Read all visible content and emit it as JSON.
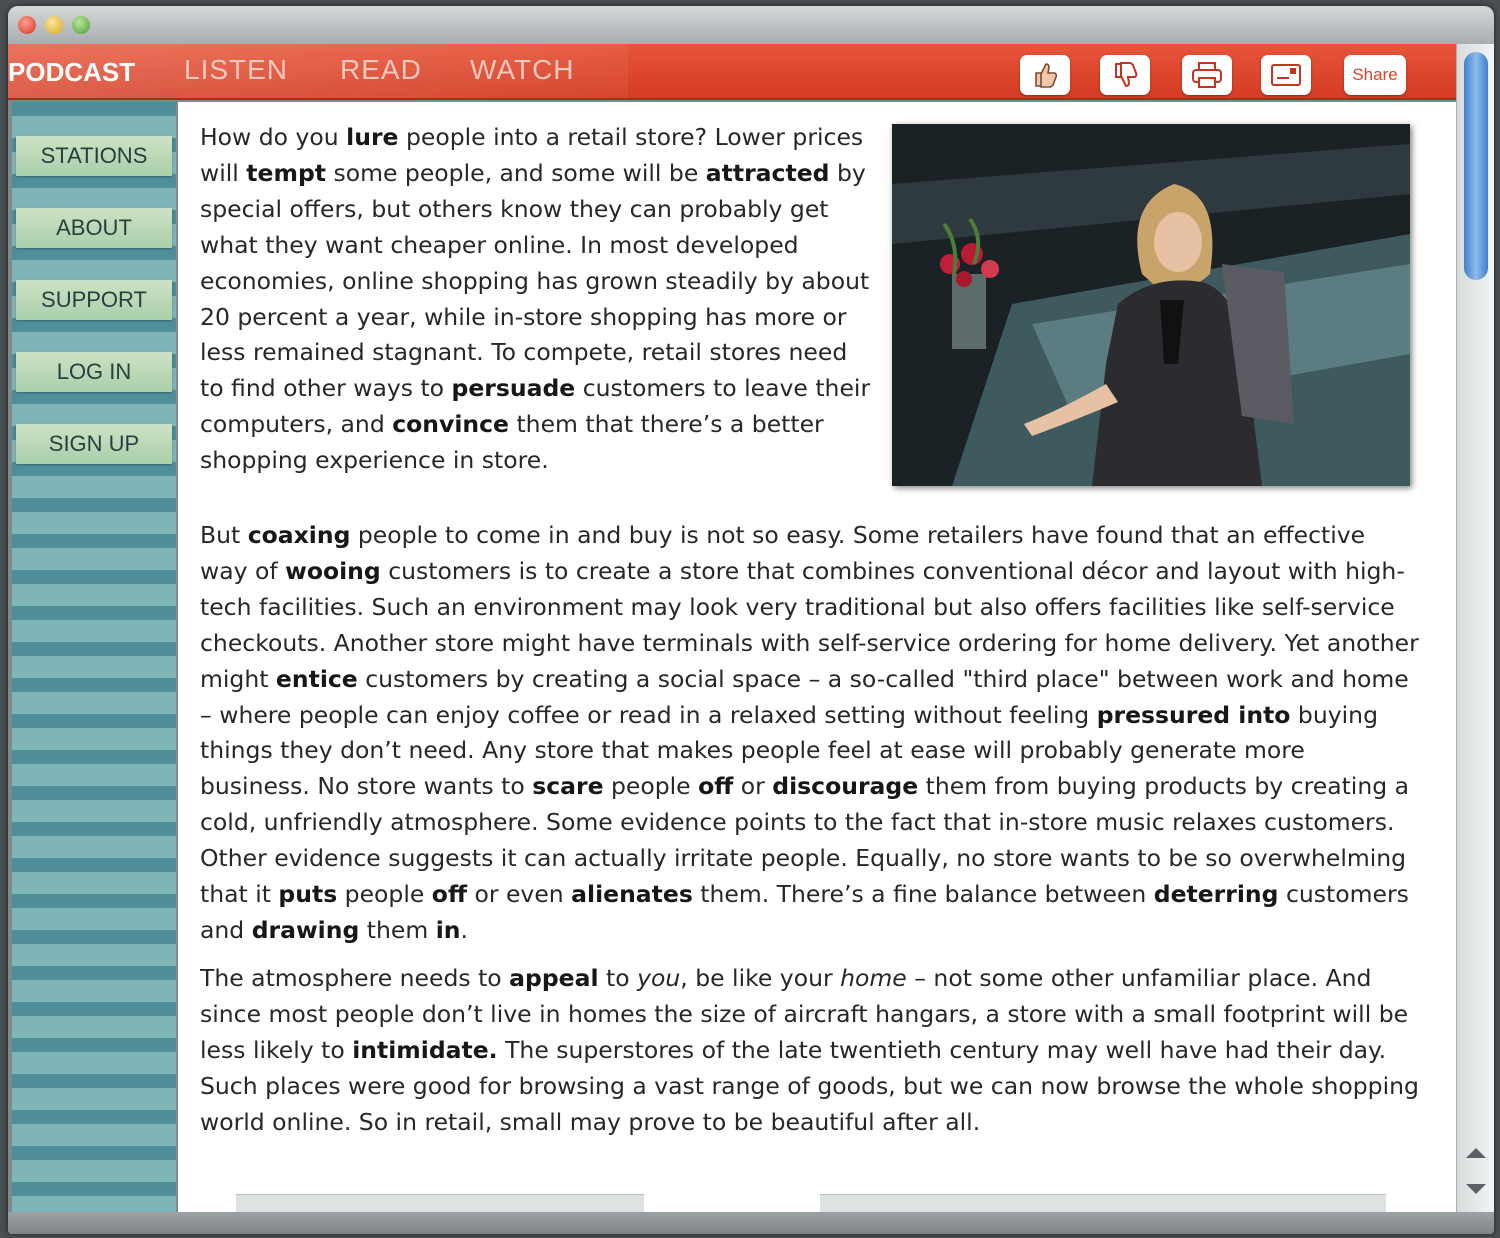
{
  "nav": {
    "podcast": "PODCAST",
    "listen": "LISTEN",
    "read": "READ",
    "watch": "WATCH"
  },
  "toolbar": {
    "like_icon": "thumbs-up-icon",
    "dislike_icon": "thumbs-down-icon",
    "print_icon": "printer-icon",
    "email_icon": "email-icon",
    "share_label": "Share"
  },
  "sidebar": {
    "items": [
      {
        "label": "STATIONS"
      },
      {
        "label": "ABOUT"
      },
      {
        "label": "SUPPORT"
      },
      {
        "label": "LOG IN"
      },
      {
        "label": "SIGN UP"
      }
    ]
  },
  "colors": {
    "brand_red": "#d94a2f",
    "sidebar_teal": "#5f9ea6",
    "button_green": "#bcd9b6"
  },
  "article": {
    "p1": [
      [
        "How do you ",
        ""
      ],
      [
        "lure",
        "b"
      ],
      [
        " people into a retail store? Lower prices will ",
        ""
      ],
      [
        "tempt",
        "b"
      ],
      [
        " some people, and some will be ",
        ""
      ],
      [
        "attracted",
        "b"
      ],
      [
        " by special offers, but others know they can probably get what they want cheaper online. In most developed economies, online shopping has grown steadily by about 20 percent a year, while in-store shopping has more or less remained stagnant. To compete, retail stores need to find other ways to ",
        ""
      ],
      [
        "persuade",
        "b"
      ],
      [
        " customers to leave their computers, and ",
        ""
      ],
      [
        "convince",
        "b"
      ],
      [
        " them that there’s a better shopping experience in store.",
        ""
      ]
    ],
    "p2": [
      [
        "But ",
        ""
      ],
      [
        "coaxing",
        "b"
      ],
      [
        " people to come in and buy is not so easy. Some retailers have found that an effective way of ",
        ""
      ],
      [
        "wooing",
        "b"
      ],
      [
        " customers is to create a store that combines conventional décor and layout with high-tech facilities. Such an environment may look very traditional but also offers facilities like self-service checkouts. Another store might have terminals with self-service ordering for home delivery. Yet another might ",
        ""
      ],
      [
        "entice",
        "b"
      ],
      [
        " customers by creating a social space – a so-called \"third place\" between work and home – where people can enjoy coffee or read in a relaxed setting without feeling ",
        ""
      ],
      [
        "pressured into",
        "b"
      ],
      [
        " buying things they don’t need. Any store that makes people feel at ease will probably generate more business. No store wants to ",
        ""
      ],
      [
        "scare",
        "b"
      ],
      [
        " people ",
        ""
      ],
      [
        "off",
        "b"
      ],
      [
        " or ",
        ""
      ],
      [
        "discourage",
        "b"
      ],
      [
        " them from buying products by creating a cold, unfriendly atmosphere. Some evidence points to the fact that in-store music relaxes customers. Other evidence suggests it can actually irritate people. Equally, no store wants to be so overwhelming that it ",
        ""
      ],
      [
        "puts",
        "b"
      ],
      [
        " people ",
        ""
      ],
      [
        "off",
        "b"
      ],
      [
        " or even ",
        ""
      ],
      [
        "alienates",
        "b"
      ],
      [
        " them. There’s a fine balance between ",
        ""
      ],
      [
        "deterring",
        "b"
      ],
      [
        " customers and ",
        ""
      ],
      [
        "drawing",
        "b"
      ],
      [
        " them ",
        ""
      ],
      [
        "in",
        "b"
      ],
      [
        ".",
        ""
      ]
    ],
    "p3": [
      [
        "The atmosphere needs to ",
        ""
      ],
      [
        "appeal",
        "b"
      ],
      [
        " to ",
        ""
      ],
      [
        "you",
        "i"
      ],
      [
        ", be like your ",
        ""
      ],
      [
        "home",
        "i"
      ],
      [
        " – not some other unfamiliar place. And since most people don’t live in homes the size of aircraft hangars, a store with a small footprint will be less likely to ",
        ""
      ],
      [
        "intimidate.",
        "b"
      ],
      [
        " The superstores of the late twentieth century may well have had their day. Such places were good for browsing a vast range of goods, but we can now browse the whole shopping world online. So in retail, small may prove to be beautiful after all.",
        ""
      ]
    ]
  }
}
